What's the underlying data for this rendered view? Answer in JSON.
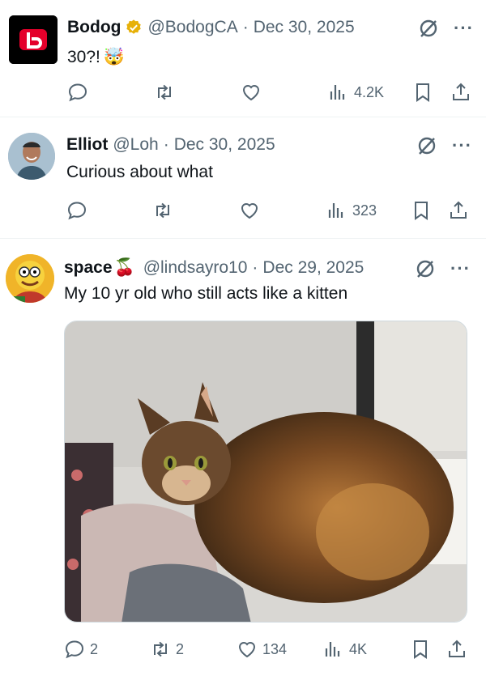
{
  "tweets": [
    {
      "name": "Bodog",
      "handle": "@BodogCA",
      "date": "Dec 30, 2025",
      "text": "30?!",
      "text_emoji": "🤯",
      "verified": true,
      "avatar_icon": "bodog-logo",
      "stats": {
        "replies": "",
        "reposts": "",
        "likes": "",
        "views": "4.2K"
      }
    },
    {
      "name": "Elliot",
      "handle": "@Loh",
      "date": "Dec 30, 2025",
      "text": "Curious about what",
      "avatar_icon": "person-photo",
      "stats": {
        "replies": "",
        "reposts": "",
        "likes": "",
        "views": "323"
      }
    },
    {
      "name": "space",
      "name_emoji": "🍒",
      "handle": "@lindsayro10",
      "date": "Dec 29, 2025",
      "text": "My 10 yr old who still acts like a kitten",
      "avatar_icon": "cartoon-avatar",
      "media": "calico-cat-photo",
      "stats": {
        "replies": "2",
        "reposts": "2",
        "likes": "134",
        "views": "4K"
      }
    }
  ],
  "separator": "·",
  "more_label": "···",
  "colors": {
    "text": "#0f1419",
    "muted": "#536471",
    "verified": "#e7b10a",
    "bodog_red": "#e4002b"
  }
}
